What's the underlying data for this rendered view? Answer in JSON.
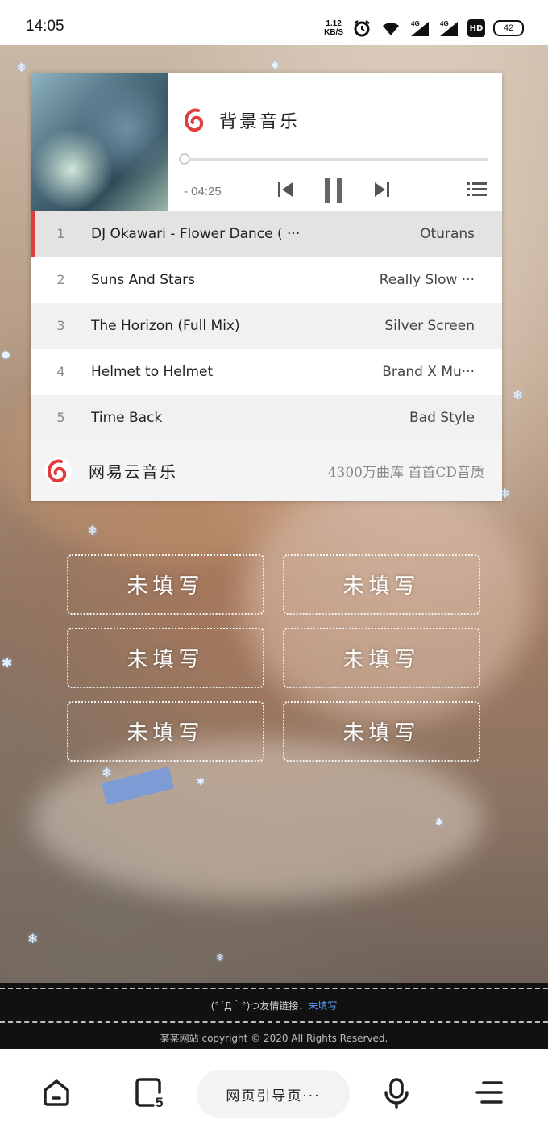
{
  "status_bar": {
    "time": "14:05",
    "net_speed_value": "1.12",
    "net_speed_unit": "KB/S",
    "signal1": "4G",
    "signal2": "4G",
    "hd": "HD",
    "battery": "42"
  },
  "player": {
    "brand_title": "背景音乐",
    "time_remaining": "- 04:25",
    "progress": 0,
    "tracks": [
      {
        "num": "1",
        "title": "DJ Okawari - Flower Dance ( ···",
        "artist": "Oturans",
        "active": true
      },
      {
        "num": "2",
        "title": "Suns And Stars",
        "artist": "Really Slow ···"
      },
      {
        "num": "3",
        "title": "The Horizon (Full Mix)",
        "artist": "Silver Screen"
      },
      {
        "num": "4",
        "title": "Helmet to Helmet",
        "artist": "Brand X Mu···"
      },
      {
        "num": "5",
        "title": "Time Back",
        "artist": "Bad Style"
      }
    ],
    "footer_name": "网易云音乐",
    "footer_tag": "4300万曲库 首首CD音质"
  },
  "links": [
    {
      "label": "未填写"
    },
    {
      "label": "未填写"
    },
    {
      "label": "未填写"
    },
    {
      "label": "未填写"
    },
    {
      "label": "未填写"
    },
    {
      "label": "未填写"
    }
  ],
  "site_footer": {
    "friend_prefix": "(°´Д｀°)つ友情链接：",
    "friend_link": "未填写",
    "copyright": "某某网站 copyright © 2020 All Rights Reserved."
  },
  "bottom_nav": {
    "tabs_count": "5",
    "address": "网页引导页···"
  },
  "colors": {
    "accent_red": "#e23b3b",
    "link_blue": "#5aa0ff"
  }
}
